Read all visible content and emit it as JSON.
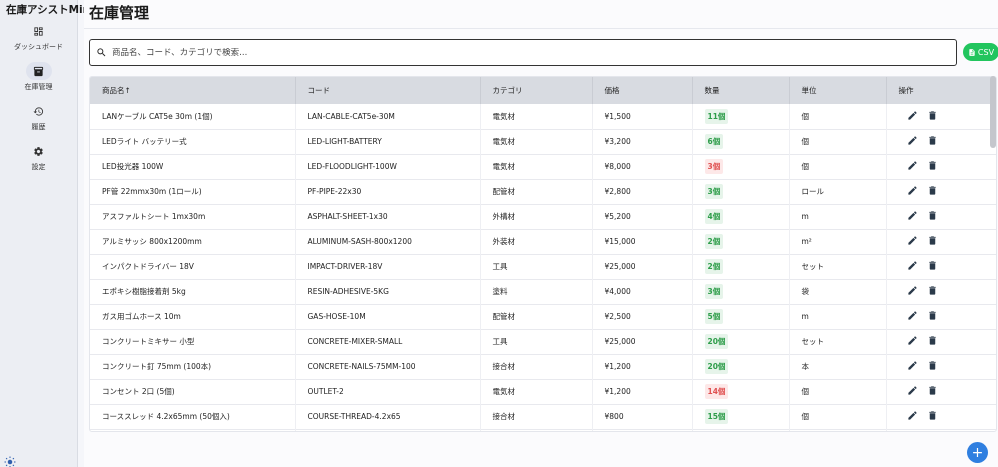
{
  "app": {
    "title": "在庫アシストMini"
  },
  "sidebar": {
    "items": [
      {
        "label": "ダッシュボード",
        "icon": "dashboard-icon",
        "active": false
      },
      {
        "label": "在庫管理",
        "icon": "inventory-icon",
        "active": true
      },
      {
        "label": "履歴",
        "icon": "history-icon",
        "active": false
      },
      {
        "label": "設定",
        "icon": "gear-icon",
        "active": false
      }
    ]
  },
  "page": {
    "title": "在庫管理"
  },
  "search": {
    "placeholder": "商品名、コード、カテゴリで検索..."
  },
  "toolbar": {
    "csv_label": "CSV"
  },
  "table": {
    "headers": [
      "商品名↑",
      "コード",
      "カテゴリ",
      "価格",
      "数量",
      "単位",
      "操作"
    ],
    "rows": [
      {
        "name": "LANケーブル CAT5e 30m (1個)",
        "code": "LAN-CABLE-CAT5e-30M",
        "category": "電気材",
        "price": "¥1,500",
        "qty": "11個",
        "status": "ok",
        "unit": "個"
      },
      {
        "name": "LEDライト バッテリー式",
        "code": "LED-LIGHT-BATTERY",
        "category": "電気材",
        "price": "¥3,200",
        "qty": "6個",
        "status": "ok",
        "unit": "個"
      },
      {
        "name": "LED投光器 100W",
        "code": "LED-FLOODLIGHT-100W",
        "category": "電気材",
        "price": "¥8,000",
        "qty": "3個",
        "status": "low",
        "unit": "個"
      },
      {
        "name": "PF管 22mmx30m (1ロール)",
        "code": "PF-PIPE-22x30",
        "category": "配管材",
        "price": "¥2,800",
        "qty": "3個",
        "status": "ok",
        "unit": "ロール"
      },
      {
        "name": "アスファルトシート 1mx30m",
        "code": "ASPHALT-SHEET-1x30",
        "category": "外構材",
        "price": "¥5,200",
        "qty": "4個",
        "status": "ok",
        "unit": "m"
      },
      {
        "name": "アルミサッシ 800x1200mm",
        "code": "ALUMINUM-SASH-800x1200",
        "category": "外装材",
        "price": "¥15,000",
        "qty": "2個",
        "status": "ok",
        "unit": "m²"
      },
      {
        "name": "インパクトドライバー 18V",
        "code": "IMPACT-DRIVER-18V",
        "category": "工具",
        "price": "¥25,000",
        "qty": "2個",
        "status": "ok",
        "unit": "セット"
      },
      {
        "name": "エポキシ樹脂接着剤 5kg",
        "code": "RESIN-ADHESIVE-5KG",
        "category": "塗料",
        "price": "¥4,000",
        "qty": "3個",
        "status": "ok",
        "unit": "袋"
      },
      {
        "name": "ガス用ゴムホース 10m",
        "code": "GAS-HOSE-10M",
        "category": "配管材",
        "price": "¥2,500",
        "qty": "5個",
        "status": "ok",
        "unit": "m"
      },
      {
        "name": "コンクリートミキサー 小型",
        "code": "CONCRETE-MIXER-SMALL",
        "category": "工具",
        "price": "¥25,000",
        "qty": "20個",
        "status": "ok",
        "unit": "セット"
      },
      {
        "name": "コンクリート釘 75mm (100本)",
        "code": "CONCRETE-NAILS-75MM-100",
        "category": "接合材",
        "price": "¥1,200",
        "qty": "20個",
        "status": "ok",
        "unit": "本"
      },
      {
        "name": "コンセント 2口 (5個)",
        "code": "OUTLET-2",
        "category": "電気材",
        "price": "¥1,200",
        "qty": "14個",
        "status": "low",
        "unit": "個"
      },
      {
        "name": "コーススレッド 4.2x65mm (50個入)",
        "code": "COURSE-THREAD-4.2x65",
        "category": "接合材",
        "price": "¥800",
        "qty": "15個",
        "status": "ok",
        "unit": "個"
      },
      {
        "name": "",
        "code": "",
        "category": "",
        "price": "",
        "qty": "",
        "status": "ok",
        "unit": ""
      }
    ]
  },
  "colors": {
    "accent": "#2f7fe0",
    "csv": "#22c55e",
    "ok": "#2e9d4a",
    "low": "#e05252"
  }
}
